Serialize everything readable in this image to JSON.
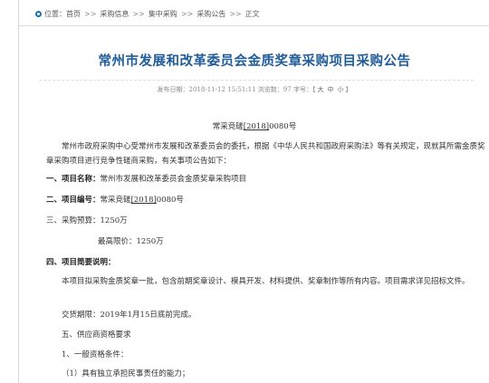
{
  "breadcrumb": {
    "prefix": "位置：",
    "items": [
      "首页",
      "采购信息",
      "集中采购",
      "采购公告",
      "正文"
    ],
    "separator": ">>"
  },
  "article": {
    "title": "常州市发展和改革委员会金质奖章采购项目采购公告",
    "meta": {
      "publish_label": "发布日期：",
      "publish_date": "2018-11-12 15:51:11",
      "views_label": "浏览数：",
      "views": "97",
      "fontsize_label": "字号：",
      "fontsize_options": [
        "大",
        "中",
        "小"
      ]
    },
    "doc_number": {
      "prefix": "常采竞磋",
      "year": "[2018]",
      "number": "0080",
      "suffix": "号"
    },
    "intro": "常州市政府采购中心受常州市发展和改革委员会的委托，根据《中华人民共和国政府采购法》等有关规定，现就其所需金质奖章采购项目进行竞争性磋商采购，有关事项公告如下：",
    "item1_label": "一、项目名称：",
    "item1_value": "常州市发展和改革委员会金质奖章采购项目",
    "item2_label": "二、项目编号：",
    "item2_value_prefix": "常采竞磋",
    "item2_value_year": "[2018]",
    "item2_value_number": "0080号",
    "item3": "三、采购预算：1250万",
    "item3b": "最高限价：1250万",
    "item4_label": "四、项目简要说明：",
    "item4_text": "本项目拟采购金质奖章一批，包含前期奖章设计、模具开发、材料提供、奖章制作等所有内容。项目需求详见招标文件。",
    "delivery": "交货期限：2019年1月15日底前完成。",
    "item5": "五、供应商资格要求",
    "item5_1": "1、一般资格条件：",
    "item5_1_1": "（1）具有独立承担民事责任的能力；"
  }
}
